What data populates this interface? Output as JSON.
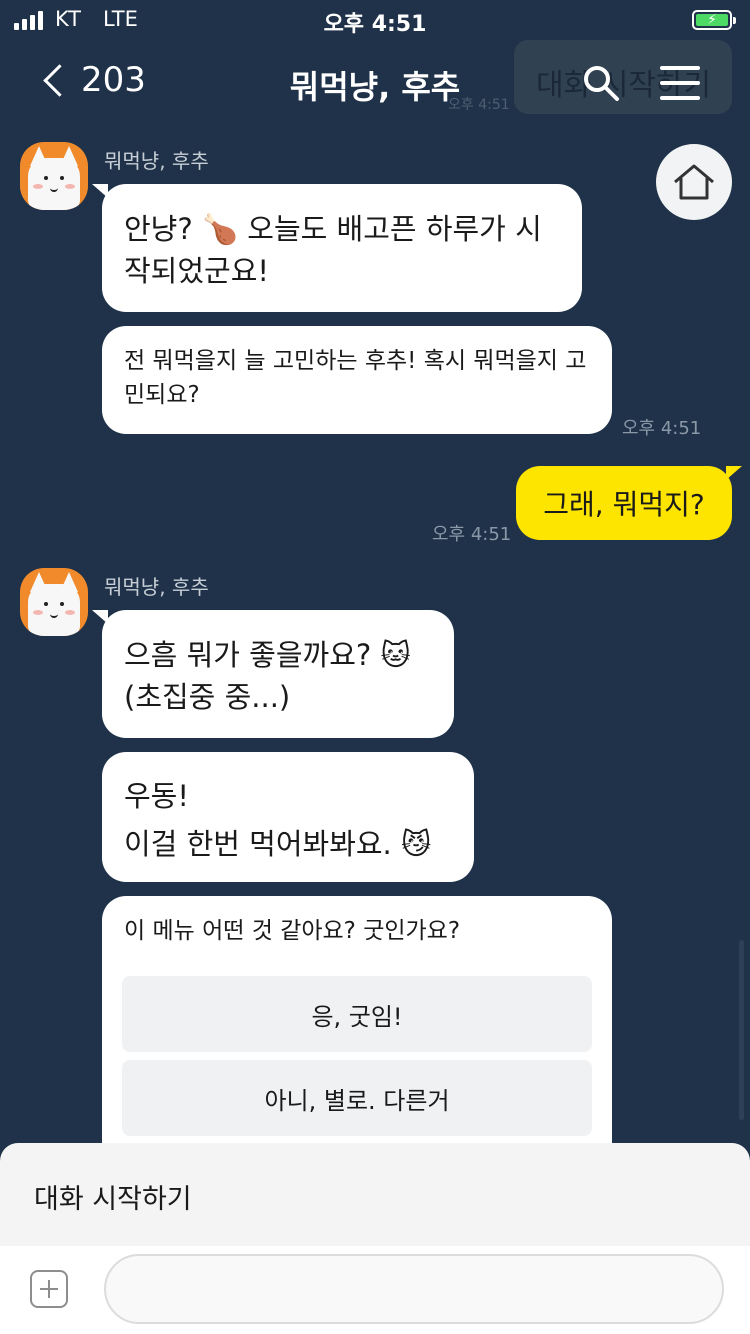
{
  "status_bar": {
    "carrier": "KT",
    "network": "LTE",
    "time": "오후 4:51"
  },
  "header": {
    "back_count": "203",
    "title": "뭐먹냥, 후추",
    "ghost_bubble": "대화 시작하기",
    "ghost_time": "오후 4:51"
  },
  "messages": {
    "sender": "뭐먹냥, 후추",
    "m1": "안냥? 🍗 오늘도 배고픈 하루가 시작되었군요!",
    "m2": "전 뭐먹을지 늘 고민하는 후추! 혹시 뭐먹을지 고민되요?",
    "m2_time": "오후 4:51",
    "mine": "그래, 뭐먹지?",
    "mine_time": "오후 4:51",
    "m3_line1": "으흠 뭐가 좋을까요? 🐱",
    "m3_line2": "(초집중 중...)",
    "m4_line1": "우동!",
    "m4_line2": "이걸 한번 먹어봐봐요. 😼",
    "m5": "이 메뉴 어떤 것 같아요? 굿인가요?",
    "choice_yes": "응, 굿임!",
    "choice_no": "아니, 별로. 다른거"
  },
  "bottom": {
    "start_label": "대화 시작하기",
    "input_value": "",
    "input_placeholder": ""
  },
  "icons": {
    "back": "chevron-left-icon",
    "search": "search-icon",
    "menu": "hamburger-menu-icon",
    "home": "home-icon",
    "plus": "plus-icon"
  },
  "colors": {
    "background": "#1f3249",
    "my_bubble": "#fee500",
    "bot_bubble": "#ffffff",
    "avatar": "#f08a2b"
  }
}
